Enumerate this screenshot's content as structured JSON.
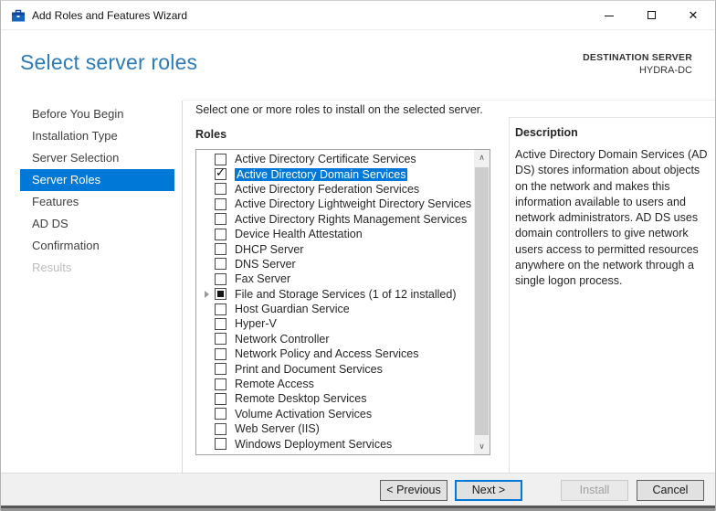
{
  "window": {
    "title": "Add Roles and Features Wizard",
    "close_glyph": "✕"
  },
  "header": {
    "title": "Select server roles",
    "destination_label": "DESTINATION SERVER",
    "destination_server": "HYDRA-DC"
  },
  "sidebar": {
    "items": [
      {
        "label": "Before You Begin",
        "state": "normal"
      },
      {
        "label": "Installation Type",
        "state": "normal"
      },
      {
        "label": "Server Selection",
        "state": "normal"
      },
      {
        "label": "Server Roles",
        "state": "selected"
      },
      {
        "label": "Features",
        "state": "normal"
      },
      {
        "label": "AD DS",
        "state": "normal"
      },
      {
        "label": "Confirmation",
        "state": "normal"
      },
      {
        "label": "Results",
        "state": "disabled"
      }
    ]
  },
  "main": {
    "instruction": "Select one or more roles to install on the selected server.",
    "roles_label": "Roles",
    "check_glyph": "✓",
    "scroll_up_glyph": "∧",
    "scroll_down_glyph": "∨",
    "roles": [
      {
        "label": "Active Directory Certificate Services",
        "state": "unchecked",
        "selected": false,
        "expander": false
      },
      {
        "label": "Active Directory Domain Services",
        "state": "checked",
        "selected": true,
        "expander": false
      },
      {
        "label": "Active Directory Federation Services",
        "state": "unchecked",
        "selected": false,
        "expander": false
      },
      {
        "label": "Active Directory Lightweight Directory Services",
        "state": "unchecked",
        "selected": false,
        "expander": false
      },
      {
        "label": "Active Directory Rights Management Services",
        "state": "unchecked",
        "selected": false,
        "expander": false
      },
      {
        "label": "Device Health Attestation",
        "state": "unchecked",
        "selected": false,
        "expander": false
      },
      {
        "label": "DHCP Server",
        "state": "unchecked",
        "selected": false,
        "expander": false
      },
      {
        "label": "DNS Server",
        "state": "unchecked",
        "selected": false,
        "expander": false
      },
      {
        "label": "Fax Server",
        "state": "unchecked",
        "selected": false,
        "expander": false
      },
      {
        "label": "File and Storage Services (1 of 12 installed)",
        "state": "mixed",
        "selected": false,
        "expander": true
      },
      {
        "label": "Host Guardian Service",
        "state": "unchecked",
        "selected": false,
        "expander": false
      },
      {
        "label": "Hyper-V",
        "state": "unchecked",
        "selected": false,
        "expander": false
      },
      {
        "label": "Network Controller",
        "state": "unchecked",
        "selected": false,
        "expander": false
      },
      {
        "label": "Network Policy and Access Services",
        "state": "unchecked",
        "selected": false,
        "expander": false
      },
      {
        "label": "Print and Document Services",
        "state": "unchecked",
        "selected": false,
        "expander": false
      },
      {
        "label": "Remote Access",
        "state": "unchecked",
        "selected": false,
        "expander": false
      },
      {
        "label": "Remote Desktop Services",
        "state": "unchecked",
        "selected": false,
        "expander": false
      },
      {
        "label": "Volume Activation Services",
        "state": "unchecked",
        "selected": false,
        "expander": false
      },
      {
        "label": "Web Server (IIS)",
        "state": "unchecked",
        "selected": false,
        "expander": false
      },
      {
        "label": "Windows Deployment Services",
        "state": "unchecked",
        "selected": false,
        "expander": false
      }
    ]
  },
  "description": {
    "heading": "Description",
    "text": "Active Directory Domain Services (AD DS) stores information about objects on the network and makes this information available to users and network administrators. AD DS uses domain controllers to give network users access to permitted resources anywhere on the network through a single logon process."
  },
  "footer": {
    "buttons": [
      {
        "label": "< Previous",
        "style": "normal"
      },
      {
        "label": "Next >",
        "style": "default"
      },
      {
        "label": "Install",
        "style": "disabled"
      },
      {
        "label": "Cancel",
        "style": "normal"
      }
    ]
  },
  "colors": {
    "accent": "#0078d7",
    "heading_blue": "#2b7bb9",
    "footer_bg": "#f0f0f0"
  }
}
